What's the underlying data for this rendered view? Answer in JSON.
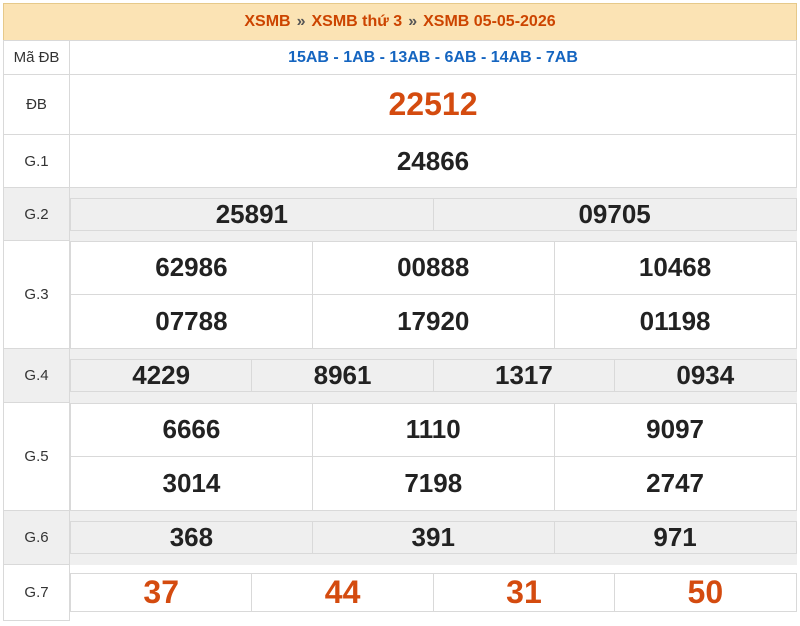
{
  "header": {
    "crumb1": "XSMB",
    "crumb2": "XSMB thứ 3",
    "crumb3": "XSMB 05-05-2026",
    "separator": "»"
  },
  "madb": {
    "label": "Mã ĐB",
    "value": "15AB - 1AB - 13AB - 6AB - 14AB - 7AB"
  },
  "prizes": {
    "db": {
      "label": "ĐB",
      "numbers": [
        "22512"
      ]
    },
    "g1": {
      "label": "G.1",
      "numbers": [
        "24866"
      ]
    },
    "g2": {
      "label": "G.2",
      "numbers": [
        "25891",
        "09705"
      ]
    },
    "g3": {
      "label": "G.3",
      "numbers": [
        "62986",
        "00888",
        "10468",
        "07788",
        "17920",
        "01198"
      ]
    },
    "g4": {
      "label": "G.4",
      "numbers": [
        "4229",
        "8961",
        "1317",
        "0934"
      ]
    },
    "g5": {
      "label": "G.5",
      "numbers": [
        "6666",
        "1110",
        "9097",
        "3014",
        "7198",
        "2747"
      ]
    },
    "g6": {
      "label": "G.6",
      "numbers": [
        "368",
        "391",
        "971"
      ]
    },
    "g7": {
      "label": "G.7",
      "numbers": [
        "37",
        "44",
        "31",
        "50"
      ]
    }
  },
  "colors": {
    "accent": "#d44b0f",
    "code_blue": "#1565c0",
    "header_bg": "#fbe3b4",
    "row_gray": "#efefef"
  }
}
